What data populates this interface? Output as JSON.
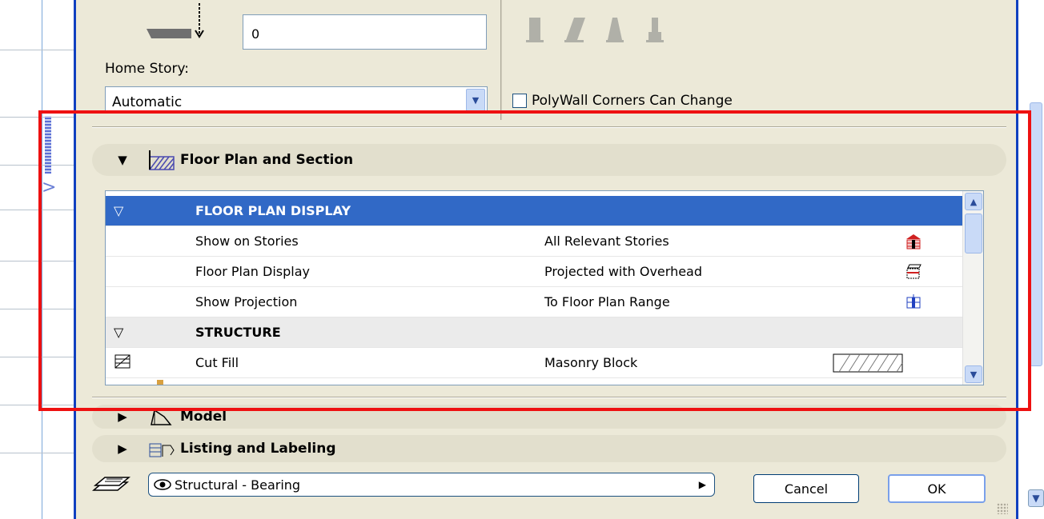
{
  "elevation": {
    "value": "0"
  },
  "home_story": {
    "label": "Home Story:",
    "selected": "Automatic"
  },
  "polywall": {
    "label": "PolyWall Corners Can Change",
    "checked": false
  },
  "panels": [
    {
      "title": "Floor Plan and Section",
      "expanded": true
    },
    {
      "title": "Model",
      "expanded": false
    },
    {
      "title": "Listing and Labeling",
      "expanded": false
    }
  ],
  "tree": {
    "group_floor_plan": "FLOOR PLAN DISPLAY",
    "rows_floor": [
      {
        "name": "Show on Stories",
        "value": "All Relevant Stories",
        "icon": "stories-icon"
      },
      {
        "name": "Floor Plan Display",
        "value": "Projected with Overhead",
        "icon": "projected-icon"
      },
      {
        "name": "Show Projection",
        "value": "To Floor Plan Range",
        "icon": "projection-range-icon"
      }
    ],
    "group_structure": "STRUCTURE",
    "rows_structure": [
      {
        "name": "Cut Fill",
        "value": "Masonry Block",
        "icon": "hatch-fill-swatch"
      }
    ]
  },
  "layer": {
    "selected": "Structural - Bearing"
  },
  "buttons": {
    "cancel": "Cancel",
    "ok": "OK"
  },
  "colors": {
    "selection": "#3169c6",
    "dialog_bg": "#ece9d8",
    "highlight": "#ee1111",
    "frame": "#1040c0"
  }
}
